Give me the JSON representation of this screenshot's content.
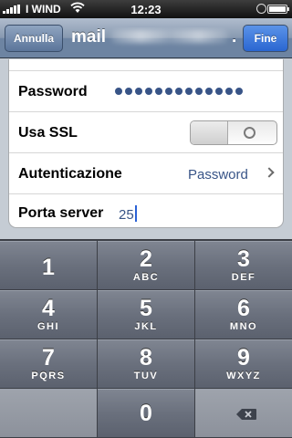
{
  "status": {
    "carrier": "I WIND",
    "time": "12:23",
    "battery_level": 1.0
  },
  "nav": {
    "cancel_label": "Annulla",
    "title": "mail",
    "title_suffix": "...",
    "done_label": "Fine"
  },
  "settings": {
    "password": {
      "label": "Password",
      "masked_length": 13
    },
    "ssl": {
      "label": "Usa SSL",
      "on": false
    },
    "auth": {
      "label": "Autenticazione",
      "value": "Password"
    },
    "port": {
      "label": "Porta server",
      "value": "25"
    }
  },
  "keypad": {
    "keys": [
      {
        "num": "1",
        "letters": ""
      },
      {
        "num": "2",
        "letters": "ABC"
      },
      {
        "num": "3",
        "letters": "DEF"
      },
      {
        "num": "4",
        "letters": "GHI"
      },
      {
        "num": "5",
        "letters": "JKL"
      },
      {
        "num": "6",
        "letters": "MNO"
      },
      {
        "num": "7",
        "letters": "PQRS"
      },
      {
        "num": "8",
        "letters": "TUV"
      },
      {
        "num": "9",
        "letters": "WXYZ"
      },
      {
        "num": "0",
        "letters": ""
      }
    ]
  },
  "icons": {
    "wifi": "wifi-icon",
    "lock": "rotation-lock-icon",
    "battery": "battery-icon",
    "chevron": "chevron-right-icon",
    "delete": "backspace-icon",
    "ssl_toggle": "toggle-off-icon"
  }
}
